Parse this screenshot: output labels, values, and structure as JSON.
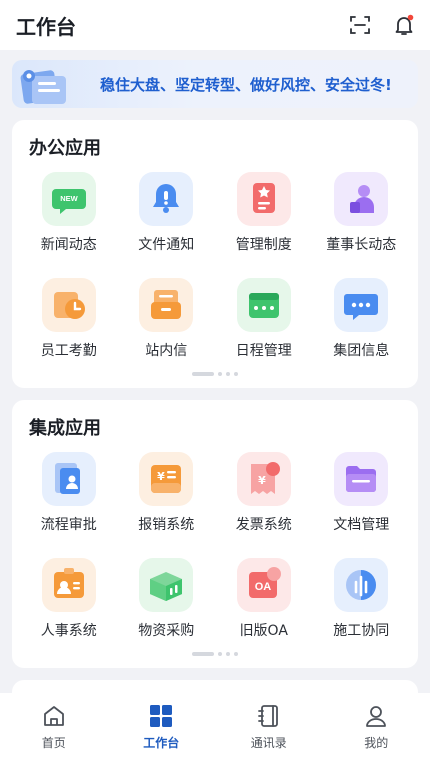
{
  "header": {
    "title": "工作台",
    "icons": [
      "scan-icon",
      "bell-icon"
    ]
  },
  "banner": {
    "text": "稳住大盘、坚定转型、做好风控、安全过冬!"
  },
  "office_section": {
    "title": "办公应用",
    "apps": [
      {
        "label": "新闻动态",
        "icon": "news-icon",
        "badge_text": "NEW"
      },
      {
        "label": "文件通知",
        "icon": "file-notice-icon"
      },
      {
        "label": "管理制度",
        "icon": "policy-icon"
      },
      {
        "label": "董事长动态",
        "icon": "chairman-icon"
      },
      {
        "label": "员工考勤",
        "icon": "attendance-icon"
      },
      {
        "label": "站内信",
        "icon": "inbox-icon"
      },
      {
        "label": "日程管理",
        "icon": "schedule-icon"
      },
      {
        "label": "集团信息",
        "icon": "group-info-icon"
      }
    ]
  },
  "integrated_section": {
    "title": "集成应用",
    "apps": [
      {
        "label": "流程审批",
        "icon": "approval-icon"
      },
      {
        "label": "报销系统",
        "icon": "reimbursement-icon"
      },
      {
        "label": "发票系统",
        "icon": "invoice-icon"
      },
      {
        "label": "文档管理",
        "icon": "document-icon"
      },
      {
        "label": "人事系统",
        "icon": "hr-icon"
      },
      {
        "label": "物资采购",
        "icon": "procurement-icon"
      },
      {
        "label": "旧版OA",
        "icon": "old-oa-icon",
        "badge_text": "OA"
      },
      {
        "label": "施工协同",
        "icon": "construction-icon"
      }
    ]
  },
  "tabbar": {
    "items": [
      {
        "label": "首页",
        "icon": "home-icon",
        "active": false
      },
      {
        "label": "工作台",
        "icon": "workbench-icon",
        "active": true
      },
      {
        "label": "通讯录",
        "icon": "contacts-icon",
        "active": false
      },
      {
        "label": "我的",
        "icon": "profile-icon",
        "active": false
      }
    ]
  },
  "colors": {
    "accent": "#1e5bbf",
    "banner_text": "#1f5fcf",
    "page_background": "#f1f2f6",
    "green": "#3ec46d",
    "blue": "#4a8cf0",
    "red": "#f26b6b",
    "purple": "#9b6ef0",
    "orange": "#f59a3a"
  }
}
